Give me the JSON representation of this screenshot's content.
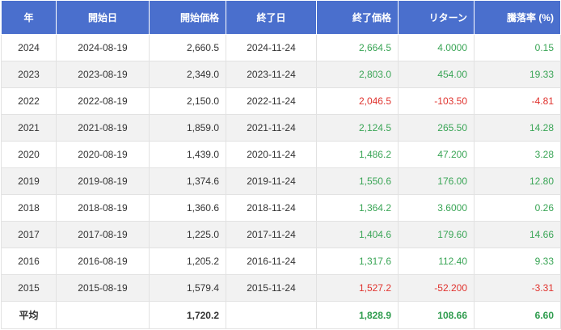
{
  "colors": {
    "header_bg": "#4a6fcd",
    "positive": "#3aa556",
    "negative": "#e0342f"
  },
  "headers": [
    "年",
    "開始日",
    "開始価格",
    "終了日",
    "終了価格",
    "リターン",
    "騰落率 (%)"
  ],
  "rows": [
    {
      "year": "2024",
      "start_date": "2024-08-19",
      "start_price": "2,660.5",
      "end_date": "2024-11-24",
      "end_price": "2,664.5",
      "return": "4.0000",
      "change_pct": "0.15",
      "sign": "pos"
    },
    {
      "year": "2023",
      "start_date": "2023-08-19",
      "start_price": "2,349.0",
      "end_date": "2023-11-24",
      "end_price": "2,803.0",
      "return": "454.00",
      "change_pct": "19.33",
      "sign": "pos"
    },
    {
      "year": "2022",
      "start_date": "2022-08-19",
      "start_price": "2,150.0",
      "end_date": "2022-11-24",
      "end_price": "2,046.5",
      "return": "-103.50",
      "change_pct": "-4.81",
      "sign": "neg"
    },
    {
      "year": "2021",
      "start_date": "2021-08-19",
      "start_price": "1,859.0",
      "end_date": "2021-11-24",
      "end_price": "2,124.5",
      "return": "265.50",
      "change_pct": "14.28",
      "sign": "pos"
    },
    {
      "year": "2020",
      "start_date": "2020-08-19",
      "start_price": "1,439.0",
      "end_date": "2020-11-24",
      "end_price": "1,486.2",
      "return": "47.200",
      "change_pct": "3.28",
      "sign": "pos"
    },
    {
      "year": "2019",
      "start_date": "2019-08-19",
      "start_price": "1,374.6",
      "end_date": "2019-11-24",
      "end_price": "1,550.6",
      "return": "176.00",
      "change_pct": "12.80",
      "sign": "pos"
    },
    {
      "year": "2018",
      "start_date": "2018-08-19",
      "start_price": "1,360.6",
      "end_date": "2018-11-24",
      "end_price": "1,364.2",
      "return": "3.6000",
      "change_pct": "0.26",
      "sign": "pos"
    },
    {
      "year": "2017",
      "start_date": "2017-08-19",
      "start_price": "1,225.0",
      "end_date": "2017-11-24",
      "end_price": "1,404.6",
      "return": "179.60",
      "change_pct": "14.66",
      "sign": "pos"
    },
    {
      "year": "2016",
      "start_date": "2016-08-19",
      "start_price": "1,205.2",
      "end_date": "2016-11-24",
      "end_price": "1,317.6",
      "return": "112.40",
      "change_pct": "9.33",
      "sign": "pos"
    },
    {
      "year": "2015",
      "start_date": "2015-08-19",
      "start_price": "1,579.4",
      "end_date": "2015-11-24",
      "end_price": "1,527.2",
      "return": "-52.200",
      "change_pct": "-3.31",
      "sign": "neg"
    }
  ],
  "average": {
    "label": "平均",
    "start_date": "",
    "start_price": "1,720.2",
    "end_date": "",
    "end_price": "1,828.9",
    "return": "108.66",
    "change_pct": "6.60",
    "sign": "pos"
  }
}
